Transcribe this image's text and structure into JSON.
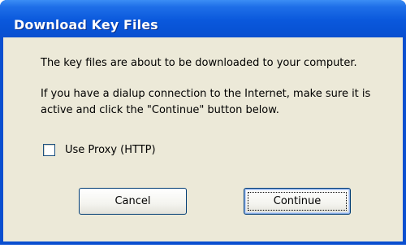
{
  "dialog": {
    "title": "Download Key Files",
    "message_line1": "The key files are about to be downloaded to your computer.",
    "message_line2a": "If you have a dialup connection to the Internet, make sure it is",
    "message_line2b": "active and click the \"Continue\" button below.",
    "proxy_checkbox": {
      "label": "Use Proxy (HTTP)",
      "checked": false
    },
    "buttons": {
      "cancel_label": "Cancel",
      "continue_label": "Continue"
    }
  }
}
